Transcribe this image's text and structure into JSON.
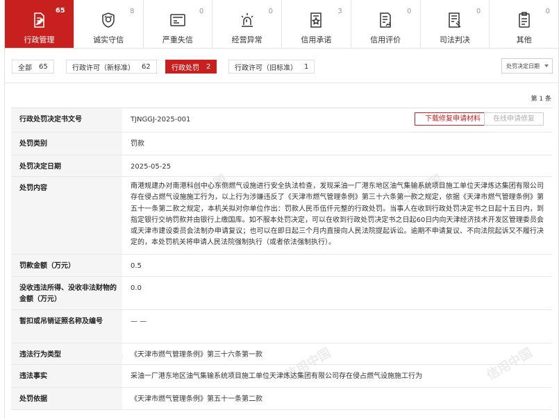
{
  "categories": [
    {
      "id": "admin",
      "label": "行政管理",
      "count": "65",
      "icon": "doc-pen-icon",
      "active": true
    },
    {
      "id": "honest",
      "label": "诚实守信",
      "count": "8",
      "icon": "shield-badge-icon"
    },
    {
      "id": "serious",
      "label": "严重失信",
      "count": "0",
      "icon": "blacklist-card-icon"
    },
    {
      "id": "abnormal",
      "label": "经营异常",
      "count": "0",
      "icon": "alarm-light-icon"
    },
    {
      "id": "promise",
      "label": "信用承诺",
      "count": "3",
      "icon": "pledge-doc-icon"
    },
    {
      "id": "evaluation",
      "label": "信用评价",
      "count": "0",
      "icon": "rating-doc-icon"
    },
    {
      "id": "judicial",
      "label": "司法判决",
      "count": "0",
      "icon": "judgment-doc-icon"
    },
    {
      "id": "other",
      "label": "其他",
      "count": "0",
      "icon": "other-doc-icon"
    }
  ],
  "filters": [
    {
      "label": "全部",
      "count": "65"
    },
    {
      "label": "行政许可（新标准）",
      "count": "62"
    },
    {
      "label": "行政处罚",
      "count": "2",
      "active": true
    },
    {
      "label": "行政许可（旧标准）",
      "count": "1"
    }
  ],
  "sort_label": "处罚决定日期",
  "page_info": "第 1 条",
  "actions": {
    "download": "下载修复申请材料",
    "online_repair": "在线申请修复"
  },
  "watermark_text": "信用中国",
  "details": [
    {
      "key": "行政处罚决定书文号",
      "value": "TJNGGJ-2025-001"
    },
    {
      "key": "处罚类别",
      "value": "罚款"
    },
    {
      "key": "处罚决定日期",
      "value": "2025-05-25"
    },
    {
      "key": "处罚内容",
      "value": "南港规建办对南港科创中心东侧燃气设施进行安全执法检查，发现采油一厂港东地区油气集输系统项目施工单位天津炼达集团有限公司存在侵占燃气设施施工行为，以上行为涉嫌违反了《天津市燃气管理条例》第三十六条第一款之规定，依据《天津市燃气管理条例》第五十一条第二款之规定，本机关拟对你单位作出：罚款人民币伍仟元整的行政处罚。当事人在收到行政处罚决定书之日起十五日内，到指定银行交纳罚款并由银行上缴国库。如不服本处罚决定，可以在收到行政处罚决定书之日起60日内向天津经济技术开发区管理委员会或天津市建设委员会法制办申请复议；也可以在即日起三个月内直接向人民法院提起诉讼。逾期不申请复议、不向法院起诉又不履行决定的，本处罚机关将申请人民法院强制执行（或者依法强制执行）。"
    },
    {
      "key": "罚款金额（万元）",
      "value": "0.5"
    },
    {
      "key": "没收违法所得、没收非法财物的金额（万元）",
      "value": "0.0"
    },
    {
      "key": "暂扣或吊销证照名称及编号",
      "value": "— —"
    },
    {
      "key": "违法行为类型",
      "value": "《天津市燃气管理条例》第三十六条第一款"
    },
    {
      "key": "违法事实",
      "value": "采油一厂港东地区油气集输系统项目施工单位天津炼达集团有限公司存在侵占燃气设施施工行为"
    },
    {
      "key": "处罚依据",
      "value": "《天津市燃气管理条例》第五十一条第二款"
    }
  ]
}
